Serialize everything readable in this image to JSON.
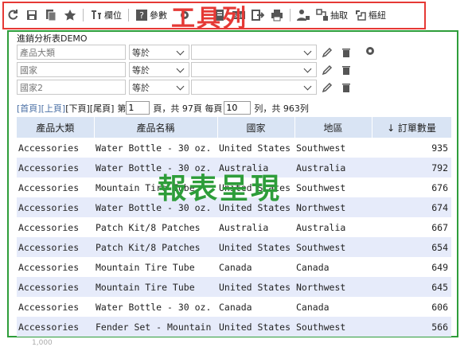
{
  "toolbar": {
    "fields_label": "欄位",
    "params_label": "參數",
    "extract_label": "抽取",
    "pivot_label": "樞紐",
    "sql_label": "SQL"
  },
  "annotations": {
    "toolbar_label": "工具列",
    "report_label": "報表呈現",
    "toolbar_color": "#e53935",
    "report_color": "#2e9d3a"
  },
  "report": {
    "title": "進銷分析表DEMO",
    "filters": [
      {
        "field": "產品大類",
        "operator": "等於",
        "value": ""
      },
      {
        "field": "國家",
        "operator": "等於",
        "value": ""
      },
      {
        "field": "國家2",
        "operator": "等於",
        "value": ""
      }
    ]
  },
  "pager": {
    "first": "[首頁]",
    "prev": "[上頁]",
    "next": "[下頁]",
    "last": "[尾頁]",
    "page_prefix": "第",
    "page_value": "1",
    "page_suffix": "頁，共 97頁 每頁",
    "per_page_value": "10",
    "rows_suffix": "列，共 963列"
  },
  "table": {
    "headers": [
      "產品大類",
      "產品名稱",
      "國家",
      "地區",
      "↓ 訂單數量"
    ],
    "rows": [
      [
        "Accessories",
        "Water Bottle - 30 oz.",
        "United States",
        "Southwest",
        "935"
      ],
      [
        "Accessories",
        "Water Bottle - 30 oz.",
        "Australia",
        "Australia",
        "792"
      ],
      [
        "Accessories",
        "Mountain Tire Tube",
        "United States",
        "Southwest",
        "676"
      ],
      [
        "Accessories",
        "Water Bottle - 30 oz.",
        "United States",
        "Northwest",
        "674"
      ],
      [
        "Accessories",
        "Patch Kit/8 Patches",
        "Australia",
        "Australia",
        "667"
      ],
      [
        "Accessories",
        "Patch Kit/8 Patches",
        "United States",
        "Southwest",
        "654"
      ],
      [
        "Accessories",
        "Mountain Tire Tube",
        "Canada",
        "Canada",
        "649"
      ],
      [
        "Accessories",
        "Mountain Tire Tube",
        "United States",
        "Northwest",
        "645"
      ],
      [
        "Accessories",
        "Water Bottle - 30 oz.",
        "Canada",
        "Canada",
        "606"
      ],
      [
        "Accessories",
        "Fender Set - Mountain",
        "United States",
        "Southwest",
        "566"
      ]
    ]
  },
  "footer_partial": "1,000"
}
